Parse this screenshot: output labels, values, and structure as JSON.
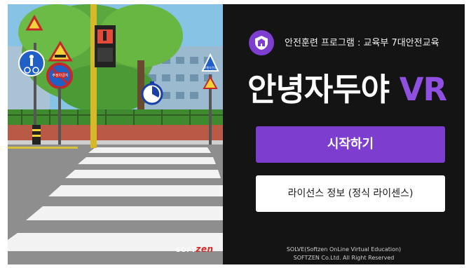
{
  "scene": {
    "sign_texts": [
      "주정차금지",
      "보행자전용"
    ],
    "logo_prefix": "SOFT",
    "logo_suffix": "zen"
  },
  "header": {
    "program_label": "안전훈련 프로그램 : 교육부 7대안전교육",
    "title_main": "안녕자두야",
    "title_suffix": "VR"
  },
  "buttons": {
    "start_label": "시작하기",
    "license_label": "라이선스 정보 (정식 라이센스)"
  },
  "footer": {
    "line1": "SOLVE(Softzen OnLine Virtual Education)",
    "line2": "SOFTZEN Co.Ltd. All Right Reserved"
  },
  "colors": {
    "accent": "#7d3ed0",
    "panel_bg": "#141414"
  },
  "icons": [
    "school-shield-icon",
    "stopwatch-icon"
  ]
}
